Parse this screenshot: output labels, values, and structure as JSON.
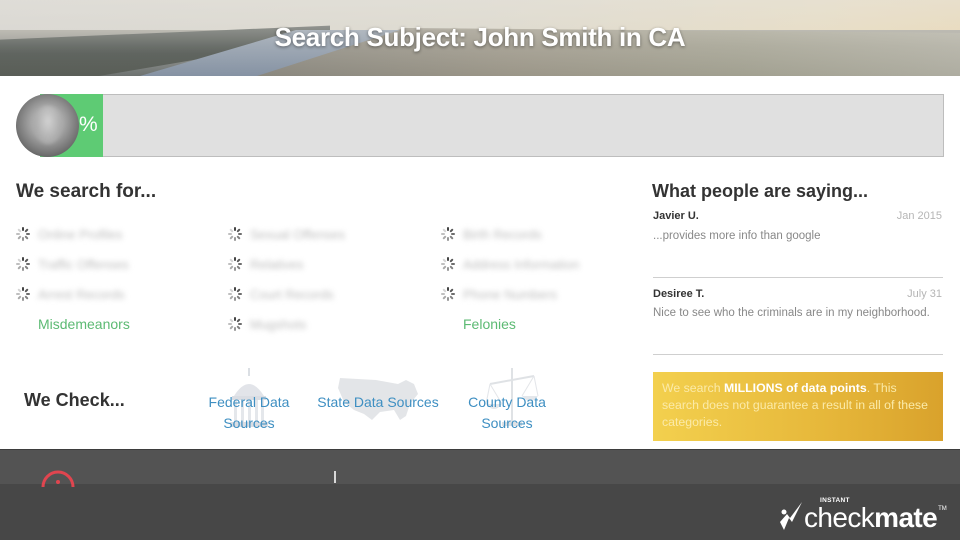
{
  "header": {
    "title": "Search Subject: John Smith in CA"
  },
  "progress": {
    "value_percent": 0,
    "label": "%",
    "fill_fraction": 0.07,
    "fill_color": "#5ecb74",
    "track_color": "#e0e0e0"
  },
  "search": {
    "title": "We search for...",
    "columns": [
      {
        "items": [
          {
            "label": "Online Profiles",
            "status": "loading"
          },
          {
            "label": "Traffic Offenses",
            "status": "loading"
          },
          {
            "label": "Arrest Records",
            "status": "loading"
          },
          {
            "label": "Misdemeanors",
            "status": "done"
          }
        ]
      },
      {
        "items": [
          {
            "label": "Sexual Offenses",
            "status": "loading"
          },
          {
            "label": "Relatives",
            "status": "loading"
          },
          {
            "label": "Court Records",
            "status": "loading"
          },
          {
            "label": "Mugshots",
            "status": "loading"
          }
        ]
      },
      {
        "items": [
          {
            "label": "Birth Records",
            "status": "loading"
          },
          {
            "label": "Address Information",
            "status": "loading"
          },
          {
            "label": "Phone Numbers",
            "status": "loading"
          },
          {
            "label": "Felonies",
            "status": "done"
          }
        ]
      }
    ],
    "done_color": "#5cba73"
  },
  "testimonials": {
    "title": "What people are saying...",
    "reviews": [
      {
        "name": "Javier U.",
        "date": "Jan 2015",
        "text": "...provides more info than google"
      },
      {
        "name": "Desiree T.",
        "date": "July 31",
        "text": "Nice to see who the criminals are in my neighborhood."
      }
    ]
  },
  "notice": {
    "prefix": "We search ",
    "bold": "MILLIONS of data points",
    "suffix": ". This search does not guarantee a result in all of these categories."
  },
  "check": {
    "title": "We Check...",
    "sources": [
      {
        "line1": "Federal Data",
        "line2": "Sources",
        "icon": "capitol-icon"
      },
      {
        "line1": "State Data Sources",
        "line2": "",
        "icon": "usa-map-icon"
      },
      {
        "line1": "County Data",
        "line2": "Sources",
        "icon": "scales-icon"
      }
    ],
    "link_color": "#3e8fc2"
  },
  "footer": {
    "logo_prefix": "INSTANT",
    "logo_main_light": "check",
    "logo_main_bold": "mate",
    "logo_tm": "TM"
  }
}
